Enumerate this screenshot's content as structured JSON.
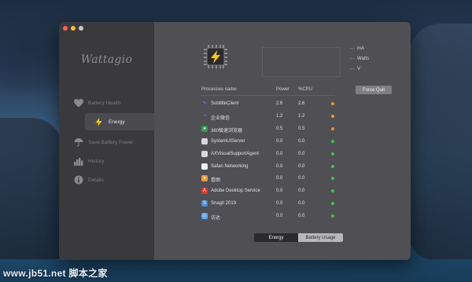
{
  "app": {
    "name": "Wattagio"
  },
  "sidebar": {
    "items": [
      {
        "label": "Battery Health",
        "icon": "heart-icon"
      },
      {
        "label": "Energy",
        "icon": "bolt-icon"
      },
      {
        "label": "Save Battery Power",
        "icon": "umbrella-icon"
      },
      {
        "label": "History",
        "icon": "history-bars-icon"
      },
      {
        "label": "Details",
        "icon": "info-icon"
      }
    ],
    "active_index": 1
  },
  "legend": [
    {
      "dash": "---",
      "label": "mA"
    },
    {
      "dash": "---",
      "label": "Watts"
    },
    {
      "dash": "---",
      "label": "V"
    }
  ],
  "table": {
    "headers": {
      "name": "Processes name",
      "power": "Power",
      "cpu": "%CPU"
    },
    "force_quit": "Force Quit",
    "rows": [
      {
        "name": "SubtitleClient",
        "power": "2.6",
        "cpu": "2.6",
        "status": "orange",
        "icon": "subtitle-client-icon"
      },
      {
        "name": "企业微信",
        "power": "1.2",
        "cpu": "1.2",
        "status": "orange",
        "icon": "wecom-icon"
      },
      {
        "name": "360极速浏览器",
        "power": "0.5",
        "cpu": "0.5",
        "status": "orange",
        "icon": "browser-360-icon"
      },
      {
        "name": "SystemUIServer",
        "power": "0.0",
        "cpu": "0.0",
        "status": "green",
        "icon": "generic-app-icon"
      },
      {
        "name": "AXVisualSupportAgent",
        "power": "0.0",
        "cpu": "0.0",
        "status": "green",
        "icon": "generic-app-icon"
      },
      {
        "name": "Safari Networking",
        "power": "0.0",
        "cpu": "0.0",
        "status": "green",
        "icon": "document-icon"
      },
      {
        "name": "看图",
        "power": "0.0",
        "cpu": "0.0",
        "status": "green",
        "icon": "image-viewer-icon"
      },
      {
        "name": "Adobe Desktop Service",
        "power": "0.0",
        "cpu": "0.0",
        "status": "green",
        "icon": "adobe-icon"
      },
      {
        "name": "Snagit 2019",
        "power": "0.0",
        "cpu": "0.0",
        "status": "green",
        "icon": "snagit-icon"
      },
      {
        "name": "访达",
        "power": "0.0",
        "cpu": "0.0",
        "status": "green",
        "icon": "finder-icon"
      }
    ]
  },
  "segmented": {
    "energy": "Energy",
    "battery_usage": "Battery Usage",
    "selected": "Energy"
  },
  "colors": {
    "status_orange": "#f0952b",
    "status_green": "#35c94a",
    "accent_bolt": "#f5c518"
  },
  "watermark": "www.jb51.net 脚本之家"
}
